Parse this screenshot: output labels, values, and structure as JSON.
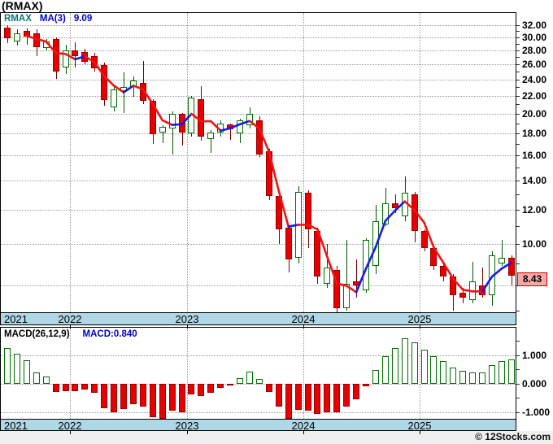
{
  "title": "(RMAX)",
  "legend": {
    "symbol": "RMAX",
    "ma_label": "MA(3)",
    "ma_value": "9.09"
  },
  "price_tag": "8.43",
  "copyright": "© 12Stocks.com",
  "macd_header": {
    "label": "MACD(26,12,9)",
    "value_label": "MACD:0.840"
  },
  "x_axis": {
    "years": [
      "2021",
      "2022",
      "2023",
      "2024",
      "2025"
    ],
    "year_boundaries": [
      null,
      6.5,
      18.5,
      30.5,
      42.5
    ]
  },
  "colors": {
    "up_outline": "#007000",
    "up_fill": "#ffffff",
    "up_wick": "#005500",
    "down_fill": "#e60000",
    "down_border": "#990000",
    "down_wick": "#7a0000",
    "ma_up": "#1a1ae6",
    "ma_down": "#f01414",
    "band": "#afd7e6",
    "grid": "#9a9a9a",
    "tag_bg": "#f7a8a8",
    "tag_border": "#cc0000",
    "legend_symbol": "#007878",
    "legend_ma": "#0000cc",
    "macd_value": "#0000cc"
  },
  "chart_data": [
    {
      "type": "candlestick",
      "symbol": "RMAX",
      "interval": "monthly",
      "scale": "log",
      "ma_period": 3,
      "ma_last": 9.09,
      "last_close": 8.43,
      "y_axis": {
        "label_texts": [
          "32.00",
          "30.00",
          "28.00",
          "26.00",
          "24.00",
          "22.00",
          "20.00",
          "18.00",
          "16.00",
          "14.00",
          "12.00",
          "10.00"
        ],
        "label_values": [
          32,
          30,
          28,
          26,
          24,
          22,
          20,
          18,
          16,
          14,
          12,
          10
        ],
        "gridline_values": [
          32,
          30,
          28,
          26,
          24,
          22,
          20,
          18,
          16,
          14,
          12,
          10,
          8
        ],
        "tick_min": 7,
        "tick_max": 32,
        "tick_step": 1
      },
      "candles": [
        [
          31.6,
          32.0,
          29.1,
          29.9
        ],
        [
          29.3,
          31.3,
          28.7,
          30.7
        ],
        [
          31.1,
          31.4,
          28.8,
          30.1
        ],
        [
          30.6,
          31.3,
          27.1,
          28.5
        ],
        [
          28.3,
          29.8,
          28.0,
          29.4
        ],
        [
          29.8,
          30.0,
          24.1,
          25.0
        ],
        [
          25.6,
          28.9,
          24.7,
          28.0
        ],
        [
          28.0,
          29.2,
          25.6,
          27.1
        ],
        [
          27.8,
          28.2,
          26.0,
          26.3
        ],
        [
          27.1,
          27.6,
          25.0,
          25.4
        ],
        [
          25.9,
          26.2,
          20.9,
          21.5
        ],
        [
          20.7,
          23.0,
          20.2,
          22.7
        ],
        [
          22.5,
          24.9,
          20.1,
          23.0
        ],
        [
          23.0,
          24.4,
          21.9,
          23.9
        ],
        [
          23.5,
          26.5,
          21.0,
          21.4
        ],
        [
          21.4,
          21.6,
          17.0,
          17.9
        ],
        [
          18.1,
          18.8,
          17.1,
          18.6
        ],
        [
          18.5,
          20.2,
          16.1,
          20.0
        ],
        [
          20.0,
          20.1,
          16.9,
          18.1
        ],
        [
          18.0,
          22.0,
          17.7,
          21.8
        ],
        [
          21.6,
          23.1,
          17.3,
          17.7
        ],
        [
          17.5,
          18.3,
          16.2,
          18.1
        ],
        [
          18.1,
          19.3,
          17.7,
          19.0
        ],
        [
          18.9,
          19.0,
          17.4,
          18.4
        ],
        [
          18.0,
          19.5,
          17.1,
          19.3
        ],
        [
          18.8,
          20.7,
          18.5,
          20.0
        ],
        [
          19.3,
          19.7,
          15.9,
          16.1
        ],
        [
          16.4,
          16.6,
          12.6,
          12.9
        ],
        [
          12.9,
          13.0,
          10.0,
          10.8
        ],
        [
          10.9,
          11.0,
          8.6,
          9.2
        ],
        [
          9.3,
          13.6,
          9.0,
          13.2
        ],
        [
          13.1,
          13.3,
          9.8,
          10.8
        ],
        [
          10.7,
          10.9,
          8.1,
          8.4
        ],
        [
          8.1,
          10.0,
          7.9,
          8.8
        ],
        [
          8.7,
          8.9,
          6.9,
          7.1
        ],
        [
          7.1,
          10.2,
          7.0,
          8.1
        ],
        [
          8.2,
          9.2,
          7.5,
          8.0
        ],
        [
          7.8,
          10.3,
          7.7,
          10.2
        ],
        [
          8.9,
          12.3,
          8.5,
          11.3
        ],
        [
          11.1,
          13.5,
          11.0,
          12.4
        ],
        [
          12.4,
          13.0,
          11.8,
          12.1
        ],
        [
          11.6,
          14.3,
          11.3,
          13.1
        ],
        [
          13.0,
          13.2,
          10.1,
          10.7
        ],
        [
          10.7,
          10.8,
          9.6,
          9.8
        ],
        [
          9.8,
          9.9,
          8.7,
          8.9
        ],
        [
          8.9,
          9.0,
          8.2,
          8.4
        ],
        [
          8.4,
          8.5,
          7.0,
          7.6
        ],
        [
          7.7,
          7.9,
          7.3,
          7.5
        ],
        [
          7.4,
          9.1,
          7.3,
          8.2
        ],
        [
          8.0,
          8.8,
          7.5,
          7.6
        ],
        [
          7.6,
          9.6,
          7.2,
          9.4
        ],
        [
          9.0,
          10.2,
          8.9,
          9.3
        ],
        [
          9.3,
          9.4,
          8.0,
          8.43
        ]
      ]
    },
    {
      "type": "bar",
      "indicator": "MACD(26,12,9)",
      "current_value": 0.84,
      "y_axis": {
        "label_texts": [
          "1.000",
          "0.000",
          "-1.000"
        ],
        "label_values": [
          1,
          0,
          -1
        ],
        "gridline_values": [
          1,
          0,
          -1
        ],
        "tick_values": [
          1.5,
          1,
          0.5,
          0,
          -0.5,
          -1
        ]
      },
      "values": [
        1.24,
        1.05,
        0.83,
        0.38,
        0.24,
        -0.29,
        -0.26,
        -0.26,
        -0.22,
        -0.33,
        -0.86,
        -1.0,
        -0.9,
        -0.71,
        -0.81,
        -1.19,
        -1.24,
        -0.95,
        -1.0,
        -0.38,
        -0.43,
        -0.33,
        -0.14,
        -0.05,
        0.19,
        0.43,
        0.16,
        -0.29,
        -0.8,
        -1.25,
        -0.91,
        -0.96,
        -1.06,
        -1.01,
        -1.01,
        -0.8,
        -0.54,
        -0.1,
        0.47,
        0.97,
        1.25,
        1.58,
        1.44,
        1.2,
        0.97,
        0.78,
        0.55,
        0.45,
        0.4,
        0.4,
        0.64,
        0.78,
        0.84
      ]
    }
  ]
}
